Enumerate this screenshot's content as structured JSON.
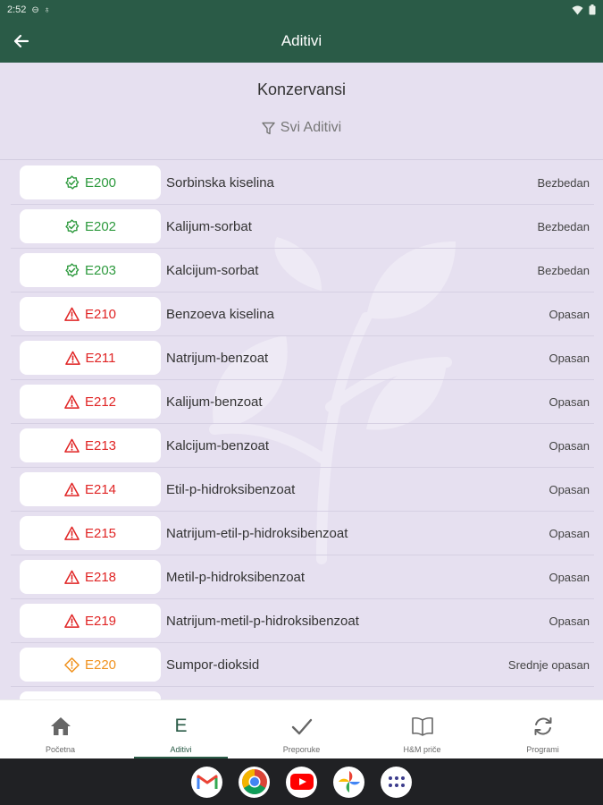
{
  "status_bar": {
    "time": "2:52"
  },
  "app_bar": {
    "title": "Aditivi"
  },
  "section": {
    "title": "Konzervansi",
    "filter_label": "Svi Aditivi"
  },
  "additives": [
    {
      "code": "E200",
      "name": "Sorbinska kiselina",
      "status": "Bezbedan",
      "level": "safe"
    },
    {
      "code": "E202",
      "name": "Kalijum-sorbat",
      "status": "Bezbedan",
      "level": "safe"
    },
    {
      "code": "E203",
      "name": "Kalcijum-sorbat",
      "status": "Bezbedan",
      "level": "safe"
    },
    {
      "code": "E210",
      "name": "Benzoeva kiselina",
      "status": "Opasan",
      "level": "danger"
    },
    {
      "code": "E211",
      "name": "Natrijum-benzoat",
      "status": "Opasan",
      "level": "danger"
    },
    {
      "code": "E212",
      "name": "Kalijum-benzoat",
      "status": "Opasan",
      "level": "danger"
    },
    {
      "code": "E213",
      "name": "Kalcijum-benzoat",
      "status": "Opasan",
      "level": "danger"
    },
    {
      "code": "E214",
      "name": "Etil-p-hidroksibenzoat",
      "status": "Opasan",
      "level": "danger"
    },
    {
      "code": "E215",
      "name": "Natrijum-etil-p-hidroksibenzoat",
      "status": "Opasan",
      "level": "danger"
    },
    {
      "code": "E218",
      "name": "Metil-p-hidroksibenzoat",
      "status": "Opasan",
      "level": "danger"
    },
    {
      "code": "E219",
      "name": "Natrijum-metil-p-hidroksibenzoat",
      "status": "Opasan",
      "level": "danger"
    },
    {
      "code": "E220",
      "name": "Sumpor-dioksid",
      "status": "Srednje opasan",
      "level": "medium"
    },
    {
      "code": "",
      "name": "",
      "status": "",
      "level": "medium"
    }
  ],
  "bottom_nav": [
    {
      "label": "Početna",
      "icon": "home-icon",
      "active": false
    },
    {
      "label": "Aditivi",
      "icon": "e-letter-icon",
      "glyph": "E",
      "active": true
    },
    {
      "label": "Preporuke",
      "icon": "check-icon",
      "active": false
    },
    {
      "label": "H&M priče",
      "icon": "book-icon",
      "active": false
    },
    {
      "label": "Programi",
      "icon": "sync-icon",
      "active": false
    }
  ],
  "dock": [
    "gmail-icon",
    "chrome-icon",
    "youtube-icon",
    "google-photos-icon",
    "app-drawer-icon"
  ],
  "colors": {
    "primary": "#2a5b47",
    "background": "#e6e0f0",
    "safe": "#2e9a3e",
    "danger": "#e02424",
    "medium": "#f0921e"
  }
}
